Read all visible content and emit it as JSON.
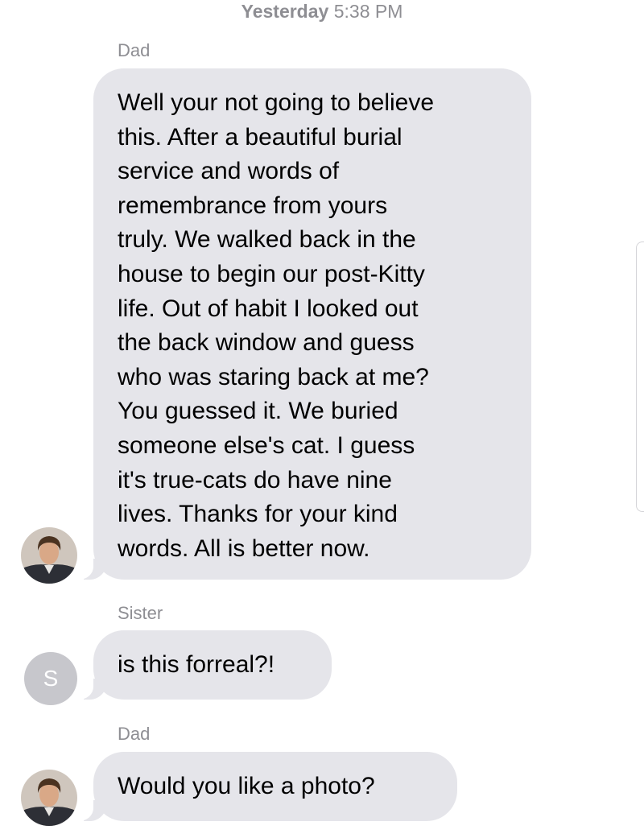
{
  "timestamp": {
    "day": "Yesterday",
    "time": "5:38 PM"
  },
  "messages": [
    {
      "sender": "Dad",
      "avatar_icon": "dad-photo-avatar",
      "text": "Well your not going to believe\nthis. After a beautiful burial\nservice and words of\nremembrance from yours\ntruly. We walked back in the\nhouse to begin our post-Kitty\nlife.  Out of habit I looked out\nthe back window and guess\nwho was staring back at me?\nYou guessed it. We buried\nsomeone else's cat. I guess\nit's true-cats do have nine\nlives. Thanks for your kind\nwords. All is better now."
    },
    {
      "sender": "Sister",
      "avatar_initial": "S",
      "text": "is this forreal?!"
    },
    {
      "sender": "Dad",
      "avatar_icon": "dad-photo-avatar",
      "text": "Would you like a photo?"
    }
  ],
  "colors": {
    "bubble_incoming": "#e5e5ea",
    "meta_text": "#8e8e93",
    "initial_avatar_bg": "#c7c7cc"
  }
}
